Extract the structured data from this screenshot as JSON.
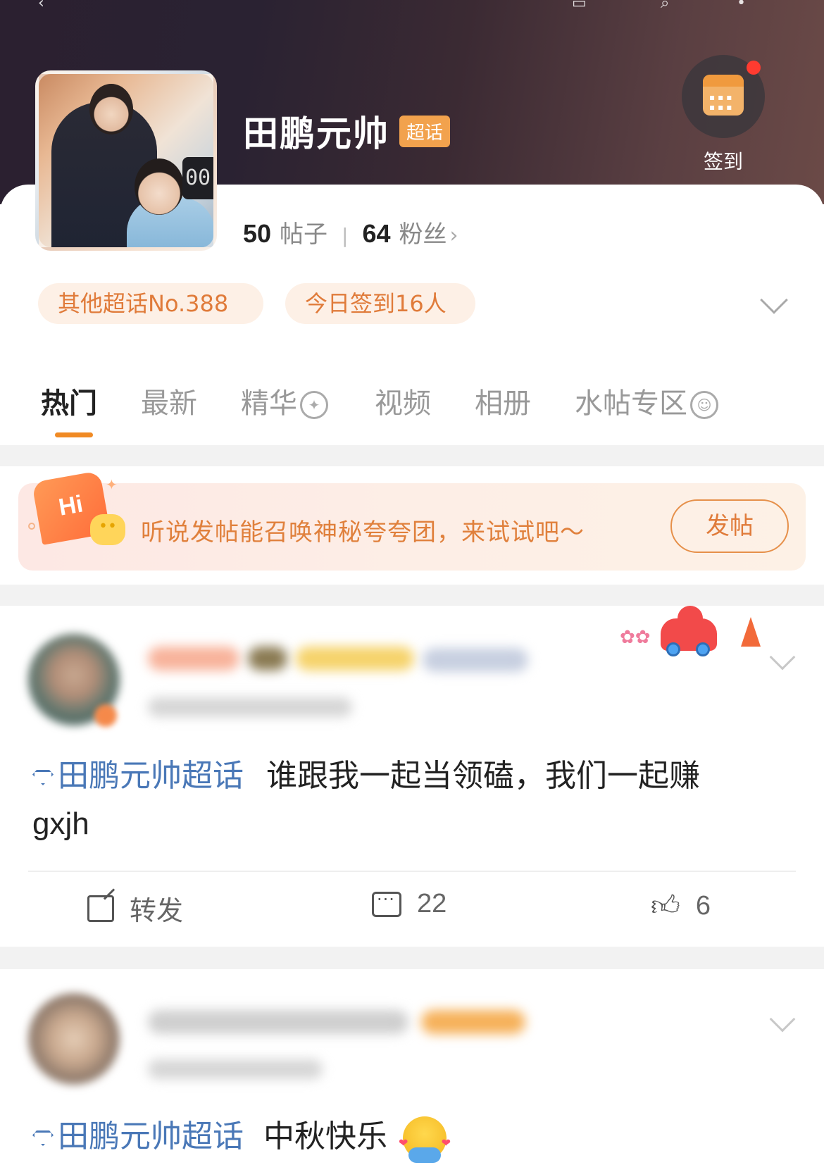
{
  "topic": {
    "name": "田鹏元帅",
    "tag": "超话",
    "posts_count": "50",
    "posts_label": "帖子",
    "fans_count": "64",
    "fans_label": "粉丝",
    "checkin_label": "签到",
    "rank_pill": "其他超话No.388",
    "today_pill": "今日签到16人"
  },
  "tabs": [
    {
      "label": "热门"
    },
    {
      "label": "最新"
    },
    {
      "label": "精华"
    },
    {
      "label": "视频"
    },
    {
      "label": "相册"
    },
    {
      "label": "水帖专区"
    }
  ],
  "banner": {
    "hi": "Hi",
    "text": "听说发帖能召唤神秘夸夸团，来试试吧～",
    "button": "发帖"
  },
  "posts": [
    {
      "topic_link": "田鹏元帅超话",
      "text_line1": "谁跟我一起当领磕，我们一起赚",
      "text_line2": "gxjh",
      "repost_label": "转发",
      "comments": "22",
      "likes": "6"
    },
    {
      "topic_link": "田鹏元帅超话",
      "text": "中秋快乐"
    }
  ],
  "colors": {
    "accent": "#f08a24",
    "link": "#4a78b7",
    "pill_text": "#e07b3a",
    "pill_bg": "#fdf0e6"
  }
}
